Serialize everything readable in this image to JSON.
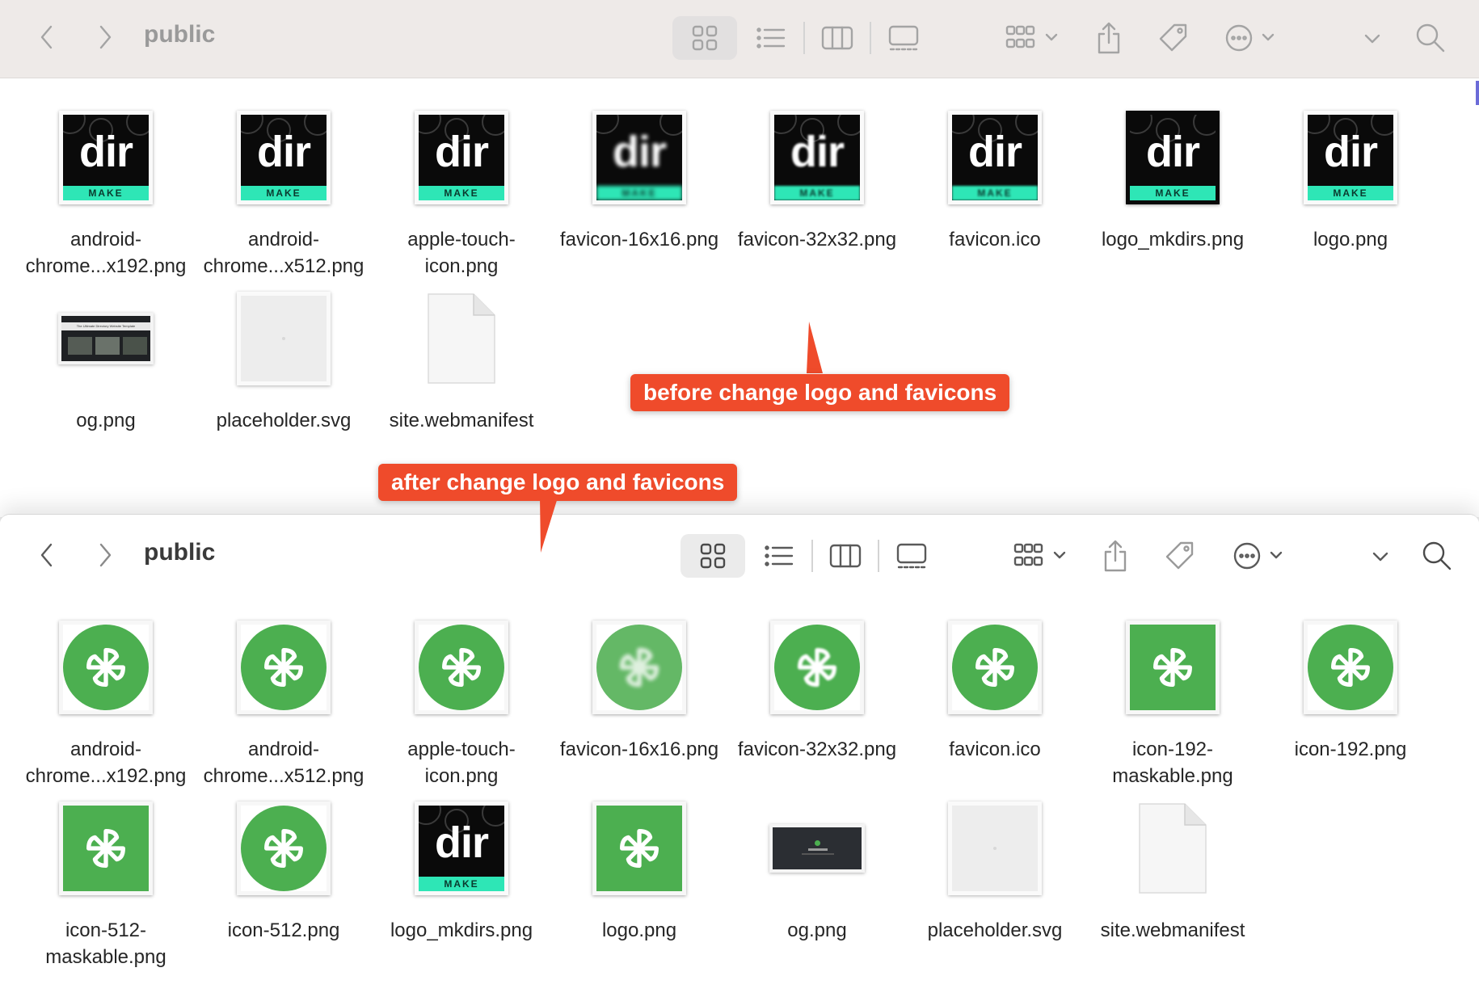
{
  "top_window": {
    "title": "public",
    "files": [
      {
        "name": "android-chrome...x192.png",
        "icon": "dir-make-logo"
      },
      {
        "name": "android-chrome...x512.png",
        "icon": "dir-make-logo"
      },
      {
        "name": "apple-touch-icon.png",
        "icon": "dir-make-logo"
      },
      {
        "name": "favicon-16x16.png",
        "icon": "dir-make-logo-pixelated"
      },
      {
        "name": "favicon-32x32.png",
        "icon": "dir-make-logo-pixelated"
      },
      {
        "name": "favicon.ico",
        "icon": "dir-make-logo"
      },
      {
        "name": "logo_mkdirs.png",
        "icon": "dir-make-logo"
      },
      {
        "name": "logo.png",
        "icon": "dir-make-logo"
      },
      {
        "name": "og.png",
        "icon": "og-preview"
      },
      {
        "name": "placeholder.svg",
        "icon": "placeholder"
      },
      {
        "name": "site.webmanifest",
        "icon": "document"
      }
    ]
  },
  "bottom_window": {
    "title": "public",
    "files": [
      {
        "name": "android-chrome...x192.png",
        "icon": "green-pinwheel-circle"
      },
      {
        "name": "android-chrome...x512.png",
        "icon": "green-pinwheel-circle"
      },
      {
        "name": "apple-touch-icon.png",
        "icon": "green-pinwheel-circle"
      },
      {
        "name": "favicon-16x16.png",
        "icon": "green-pinwheel-circle-pixelated"
      },
      {
        "name": "favicon-32x32.png",
        "icon": "green-pinwheel-circle-pixelated"
      },
      {
        "name": "favicon.ico",
        "icon": "green-pinwheel-circle"
      },
      {
        "name": "icon-192-maskable.png",
        "icon": "green-pinwheel-square"
      },
      {
        "name": "icon-192.png",
        "icon": "green-pinwheel-circle"
      },
      {
        "name": "icon-512-maskable.png",
        "icon": "green-pinwheel-square"
      },
      {
        "name": "icon-512.png",
        "icon": "green-pinwheel-circle"
      },
      {
        "name": "logo_mkdirs.png",
        "icon": "dir-make-logo"
      },
      {
        "name": "logo.png",
        "icon": "green-pinwheel-square"
      },
      {
        "name": "og.png",
        "icon": "og-preview-dark"
      },
      {
        "name": "placeholder.svg",
        "icon": "placeholder"
      },
      {
        "name": "site.webmanifest",
        "icon": "document"
      }
    ]
  },
  "logo_text": {
    "word": "dir",
    "tag": "MAKE"
  },
  "og_thumb_text": "The Ultimate Directory Website Template",
  "callouts": {
    "before": "before change logo and favicons",
    "after": "after change logo and favicons"
  },
  "colors": {
    "callout": "#ef4b2b",
    "green": "#4caf50",
    "teal_bar": "#2ee6b6"
  },
  "toolbar_icons": [
    "back-chevron-icon",
    "forward-chevron-icon",
    "icon-view-icon",
    "list-view-icon",
    "column-view-icon",
    "gallery-view-icon",
    "group-icon",
    "share-icon",
    "tag-icon",
    "more-actions-icon",
    "search-icon"
  ]
}
